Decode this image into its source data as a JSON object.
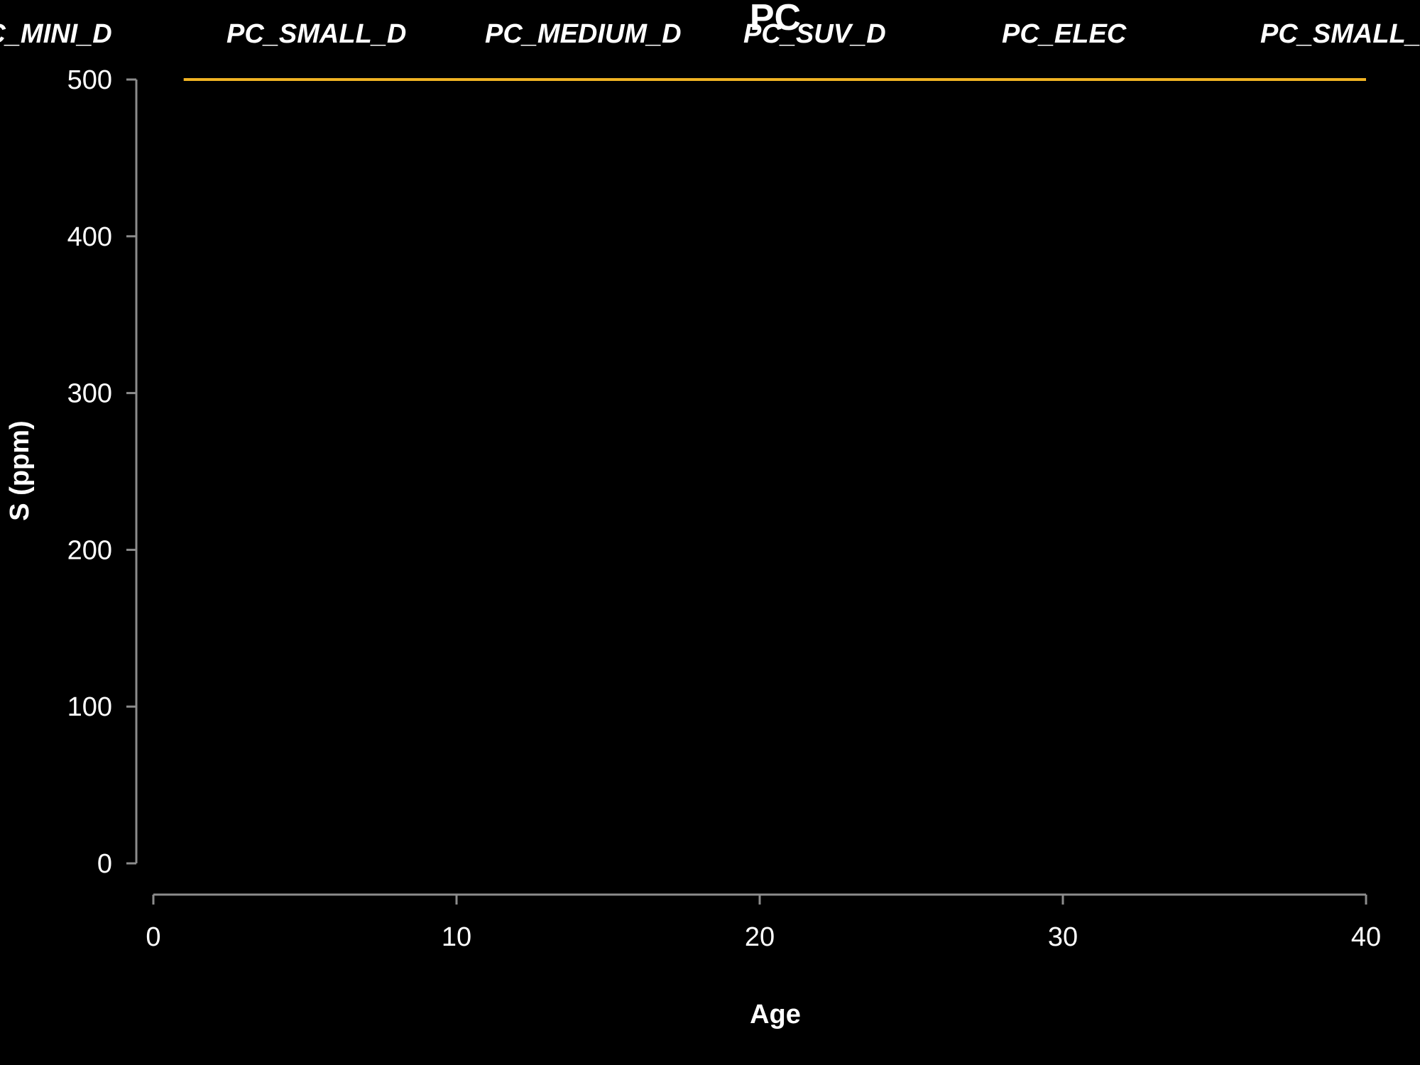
{
  "chart_data": {
    "type": "line",
    "title": "PC",
    "xlabel": "Age",
    "ylabel": "S (ppm)",
    "xlim": [
      0,
      40
    ],
    "ylim": [
      0,
      500
    ],
    "x_ticks": [
      0,
      10,
      20,
      30,
      40
    ],
    "y_ticks": [
      0,
      100,
      200,
      300,
      400,
      500
    ],
    "legend_placement": "top",
    "legend_entries": [
      "PC_MINI_D",
      "PC_SMALL_D",
      "PC_MEDIUM_D",
      "PC_SUV_D",
      "PC_ELEC",
      "PC_SMALL_HY"
    ],
    "grid": false,
    "background_color": "#000000",
    "axis_color": "#8c8c8c",
    "text_color": "#ffffff",
    "series": [
      {
        "color": "#f0b323",
        "x": [
          1,
          40
        ],
        "y": [
          500,
          500
        ]
      }
    ]
  }
}
